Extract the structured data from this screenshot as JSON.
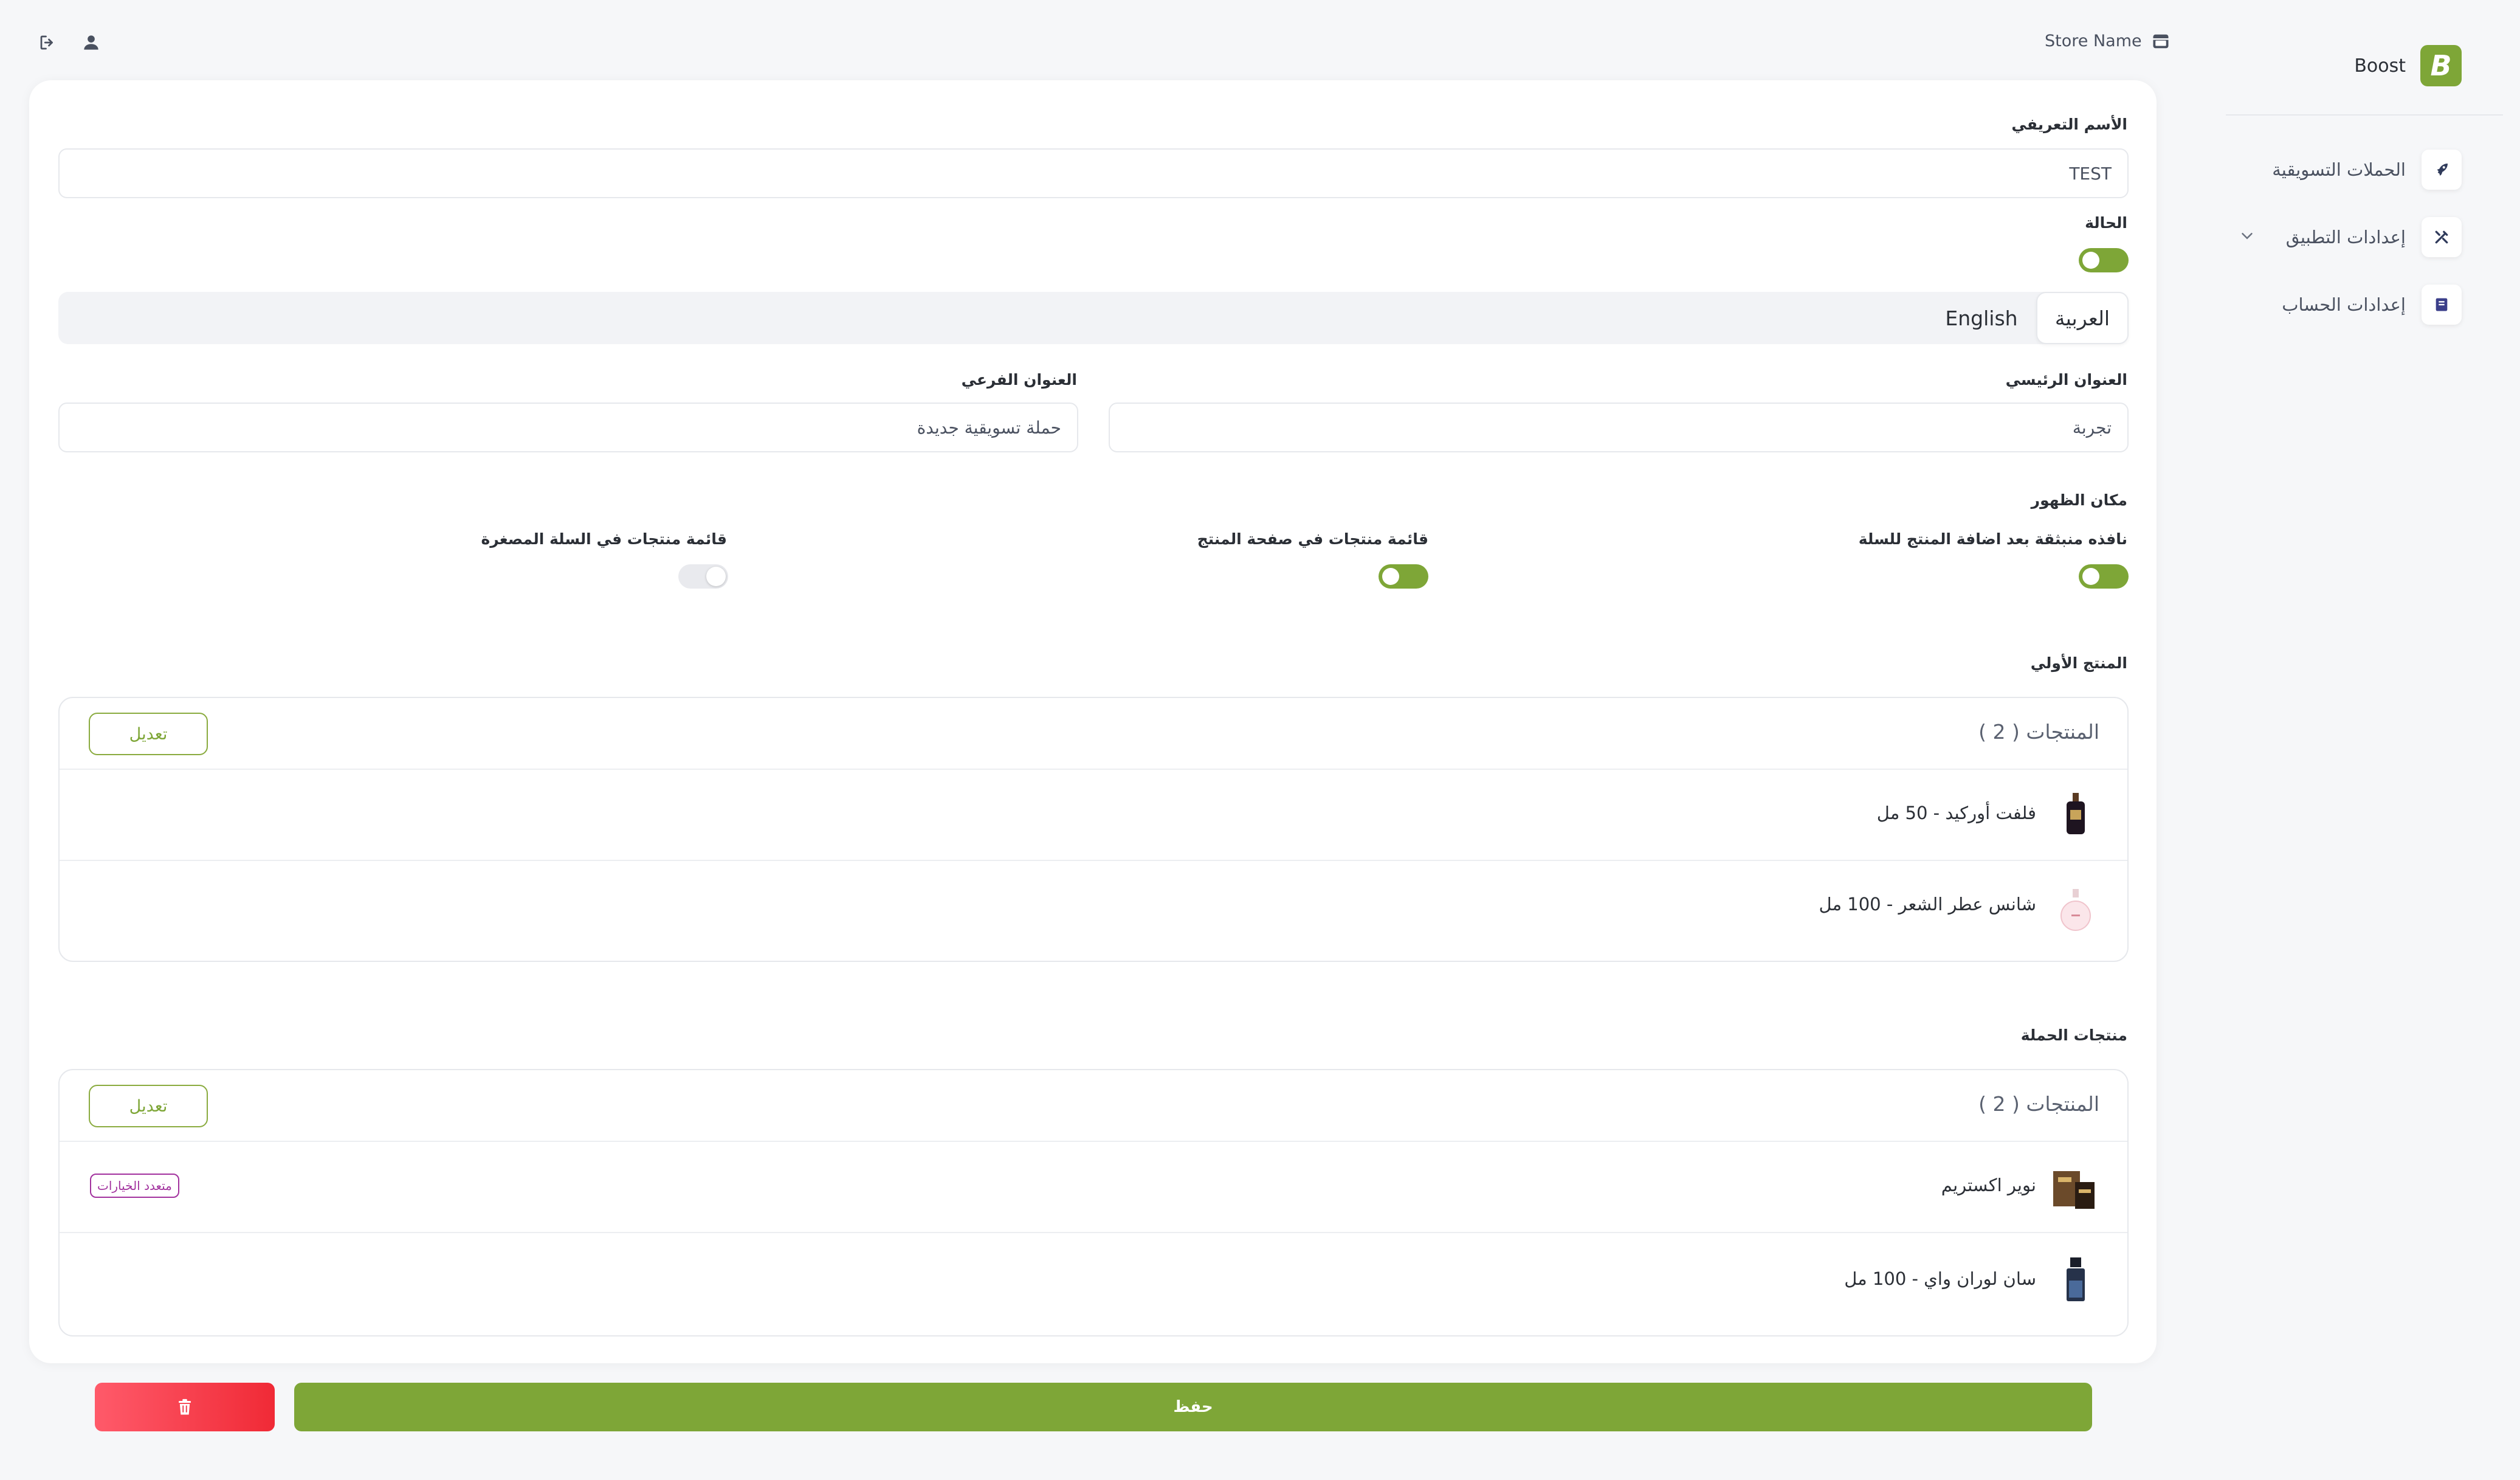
{
  "header": {
    "store_name": "Store Name"
  },
  "sidebar": {
    "brand": "Boost",
    "brand_letter": "B",
    "items": [
      {
        "label": "الحملات التسويقية",
        "icon": "rocket-icon"
      },
      {
        "label": "إعدادات التطبيق",
        "icon": "tools-icon"
      },
      {
        "label": "إعدادات الحساب",
        "icon": "account-book-icon"
      }
    ]
  },
  "form": {
    "identifier_label": "الأسم التعريفي",
    "identifier_value": "TEST",
    "status_label": "الحالة",
    "status_on": true,
    "languages": [
      "العربية",
      "English"
    ],
    "active_language": "العربية",
    "main_title_label": "العنوان الرئيسي",
    "main_title_value": "تجربة",
    "subtitle_label": "العنوان الفرعي",
    "subtitle_value": "حملة تسويقية جديدة",
    "placement_label": "مكان الظهور",
    "placements": [
      {
        "label": "نافذه منبثقة بعد اضافة المنتج للسلة",
        "enabled": true
      },
      {
        "label": "قائمة منتجات في صفحة المنتج",
        "enabled": true
      },
      {
        "label": "قائمة منتجات في السلة المصغرة",
        "enabled": false
      }
    ]
  },
  "initial_products": {
    "label": "المنتج الأولي",
    "header": "المنتجات ( 2 )",
    "edit_label": "تعديل",
    "items": [
      {
        "name": "فلفت أوركيد - 50 مل"
      },
      {
        "name": "شانس عطر الشعر - 100 مل"
      }
    ]
  },
  "campaign_products": {
    "label": "منتجات الحملة",
    "header": "المنتجات ( 2 )",
    "edit_label": "تعديل",
    "items": [
      {
        "name": "نوير اكستريم",
        "badge": "متعدد الخيارات"
      },
      {
        "name": "سان لوران واي - 100 مل"
      }
    ]
  },
  "actions": {
    "save_label": "حفظ"
  },
  "colors": {
    "accent": "#7ea637",
    "danger": "#f02a36",
    "badge": "#a2329e"
  }
}
